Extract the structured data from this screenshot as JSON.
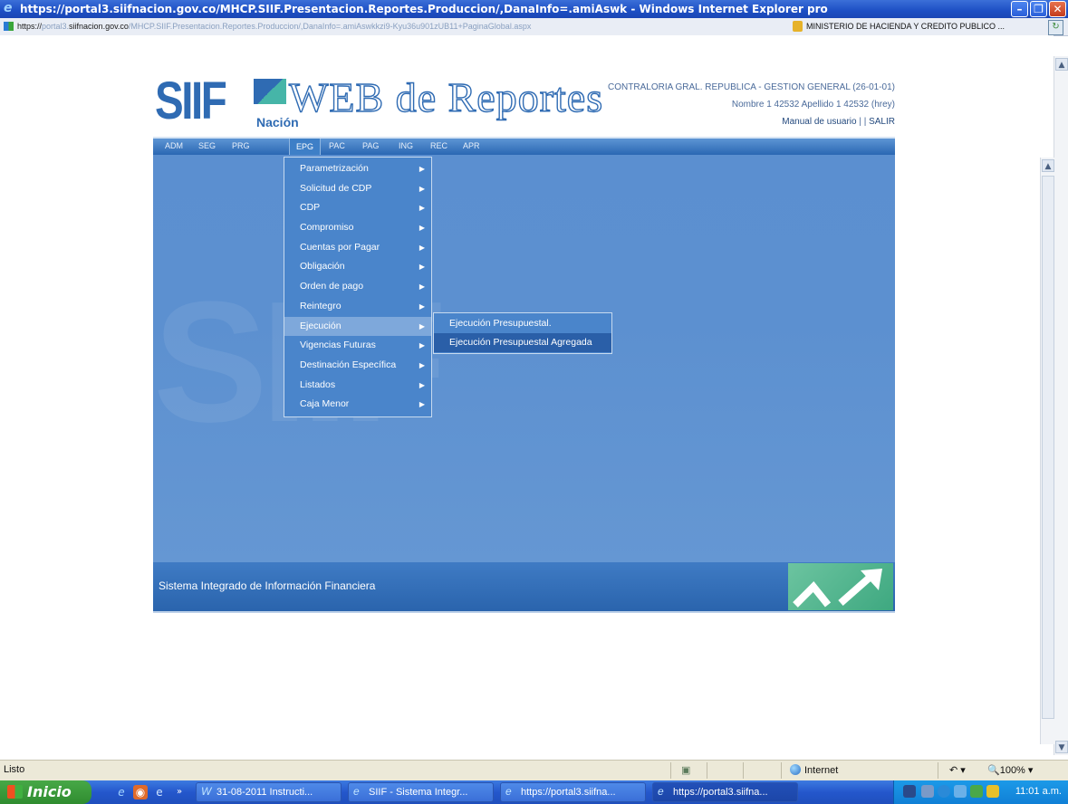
{
  "window": {
    "title": "https://portal3.siifnacion.gov.co/MHCP.SIIF.Presentacion.Reportes.Produccion/,DanaInfo=.amiAswk - Windows Internet Explorer pro",
    "url_prefix": "https://",
    "url_host": "portal3.",
    "url_domain": "siifnacion.gov.co",
    "url_path": "/MHCP.SIIF.Presentacion.Reportes.Produccion/,DanaInfo=.amiAswkkzi9-Kyu36u901zUB11+PaginaGlobal.aspx",
    "cert_label": "MINISTERIO DE HACIENDA Y CREDITO PUBLICO ..."
  },
  "app": {
    "logo_text": "SIIF",
    "logo_sub": "Nación",
    "title": "WEB de Reportes",
    "entity": "CONTRALORIA GRAL. REPUBLICA - GESTION GENERAL (26-01-01)",
    "user": "Nombre 1 42532 Apellido 1 42532 (hrey)",
    "manual_link": "Manual de usuario",
    "sep": " | | ",
    "logout_link": "SALIR",
    "footer_text": "Sistema Integrado de Información Financiera"
  },
  "nav": [
    "ADM",
    "SEG",
    "PRG",
    "EPG",
    "PAC",
    "PAG",
    "ING",
    "REC",
    "APR"
  ],
  "menu": {
    "items": [
      "Parametrización",
      "Solicitud de CDP",
      "CDP",
      "Compromiso",
      "Cuentas por Pagar",
      "Obligación",
      "Orden de pago",
      "Reintegro",
      "Ejecución",
      "Vigencias Futuras",
      "Destinación Específica",
      "Listados",
      "Caja Menor"
    ],
    "highlighted": "Ejecución",
    "submenu": [
      "Ejecución Presupuestal.",
      "Ejecución Presupuestal Agregada"
    ]
  },
  "status": {
    "text": "Listo",
    "zone": "Internet",
    "zoom": "100%"
  },
  "taskbar": {
    "start": "Inicio",
    "tasks": [
      "31-08-2011 Instructi...",
      "SIIF - Sistema Integr...",
      "https://portal3.siifna...",
      "https://portal3.siifna..."
    ],
    "clock": "11:01 a.m."
  },
  "colors": {
    "brand_blue": "#2f6bb3",
    "panel_blue": "#5b8fd0",
    "menu_bg": "#4a85cb",
    "menu_highlight": "#7ea8db"
  }
}
